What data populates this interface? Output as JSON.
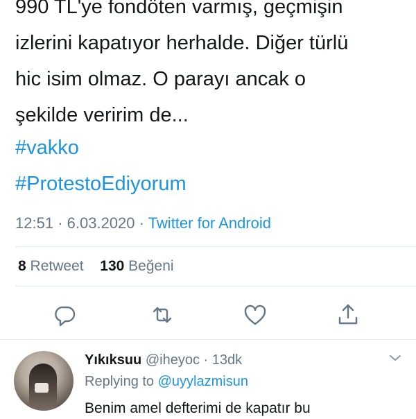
{
  "tweet": {
    "lines": [
      "990 TL'ye fondöten varmış, geçmişin",
      "izlerini kapatıyor herhalde. Diğer türlü",
      "hic isim olmaz. O parayı ancak o",
      "şekilde veririm de..."
    ],
    "hashtags": [
      "#vakko",
      "#ProtestoEdiyorum"
    ],
    "time": "12:51",
    "date": "6.03.2020",
    "separator": "·",
    "source": "Twitter for Android"
  },
  "stats": {
    "retweet_count": "8",
    "retweet_label": "Retweet",
    "like_count": "130",
    "like_label": "Beğeni"
  },
  "actions": {
    "reply_icon": "comment-icon",
    "retweet_icon": "retweet-icon",
    "like_icon": "heart-icon",
    "share_icon": "share-icon"
  },
  "reply": {
    "display_name": "Yıkıksuu",
    "handle": "@iheyoc",
    "separator": "·",
    "time": "13dk",
    "replying_prefix": "Replying to",
    "replying_to": "@uyylazmisun",
    "text": "Benim amel defterimi de kapatır bu"
  },
  "colors": {
    "accent": "#1b95e0",
    "muted": "#657786",
    "text": "#14171a",
    "divider": "#e1e8ed"
  }
}
